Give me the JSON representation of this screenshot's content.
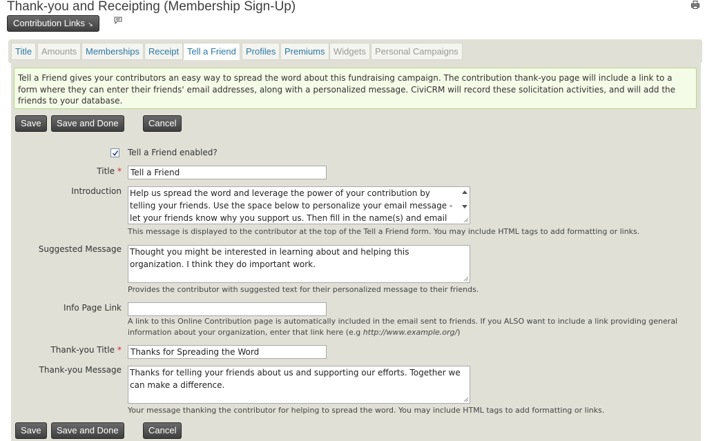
{
  "page": {
    "title": "Thank-you and Receipting (Membership Sign-Up)"
  },
  "toolbar": {
    "contribution_links_label": "Contribution Links",
    "contribution_links_arrow": "↘"
  },
  "tabs": [
    {
      "label": "Title",
      "state": "enabled"
    },
    {
      "label": "Amounts",
      "state": "disabled"
    },
    {
      "label": "Memberships",
      "state": "enabled"
    },
    {
      "label": "Receipt",
      "state": "enabled"
    },
    {
      "label": "Tell a Friend",
      "state": "active"
    },
    {
      "label": "Profiles",
      "state": "enabled"
    },
    {
      "label": "Premiums",
      "state": "enabled"
    },
    {
      "label": "Widgets",
      "state": "disabled"
    },
    {
      "label": "Personal Campaigns",
      "state": "disabled"
    }
  ],
  "info": {
    "text": "Tell a Friend gives your contributors an easy way to spread the word about this fundraising campaign. The contribution thank-you page will include a link to a form where they can enter their friends' email addresses, along with a personalized message. CiviCRM will record these solicitation activities, and will add the friends to your database."
  },
  "buttons": {
    "save": "Save",
    "save_and_done": "Save and Done",
    "cancel": "Cancel"
  },
  "form": {
    "enabled": {
      "label": "Tell a Friend enabled?",
      "checked": true
    },
    "title": {
      "label": "Title",
      "required_mark": "*",
      "value": "Tell a Friend"
    },
    "introduction": {
      "label": "Introduction",
      "value": "Help us spread the word and leverage the power of your contribution by telling your friends. Use the space below to personalize your email message - let your friends know why you support us. Then fill in the name(s) and email address(es)",
      "help": "This message is displayed to the contributor at the top of the Tell a Friend form. You may include HTML tags to add formatting or links."
    },
    "suggested_message": {
      "label": "Suggested Message",
      "value": "Thought you might be interested in learning about and helping this organization. I think they do important work.",
      "help": "Provides the contributor with suggested text for their personalized message to their friends."
    },
    "info_page_link": {
      "label": "Info Page Link",
      "value": "",
      "help_prefix": "A link to this Online Contribution page is automatically included in the email sent to friends. If you ALSO want to include a link providing general information about your organization, enter that link here (e.g ",
      "help_example": "http://www.example.org/",
      "help_suffix": ")"
    },
    "thankyou_title": {
      "label": "Thank-you Title",
      "required_mark": "*",
      "value": "Thanks for Spreading the Word"
    },
    "thankyou_message": {
      "label": "Thank-you Message",
      "value": "Thanks for telling your friends about us and supporting our efforts. Together we can make a difference.",
      "help": "Your message thanking the contributor for helping to spread the word. You may include HTML tags to add formatting or links."
    }
  },
  "colors": {
    "link": "#2a78a4",
    "panel": "#e0e0d6",
    "button": "#4a4a4a",
    "required": "#d8232a",
    "info_bg": "#f4fbe6"
  }
}
